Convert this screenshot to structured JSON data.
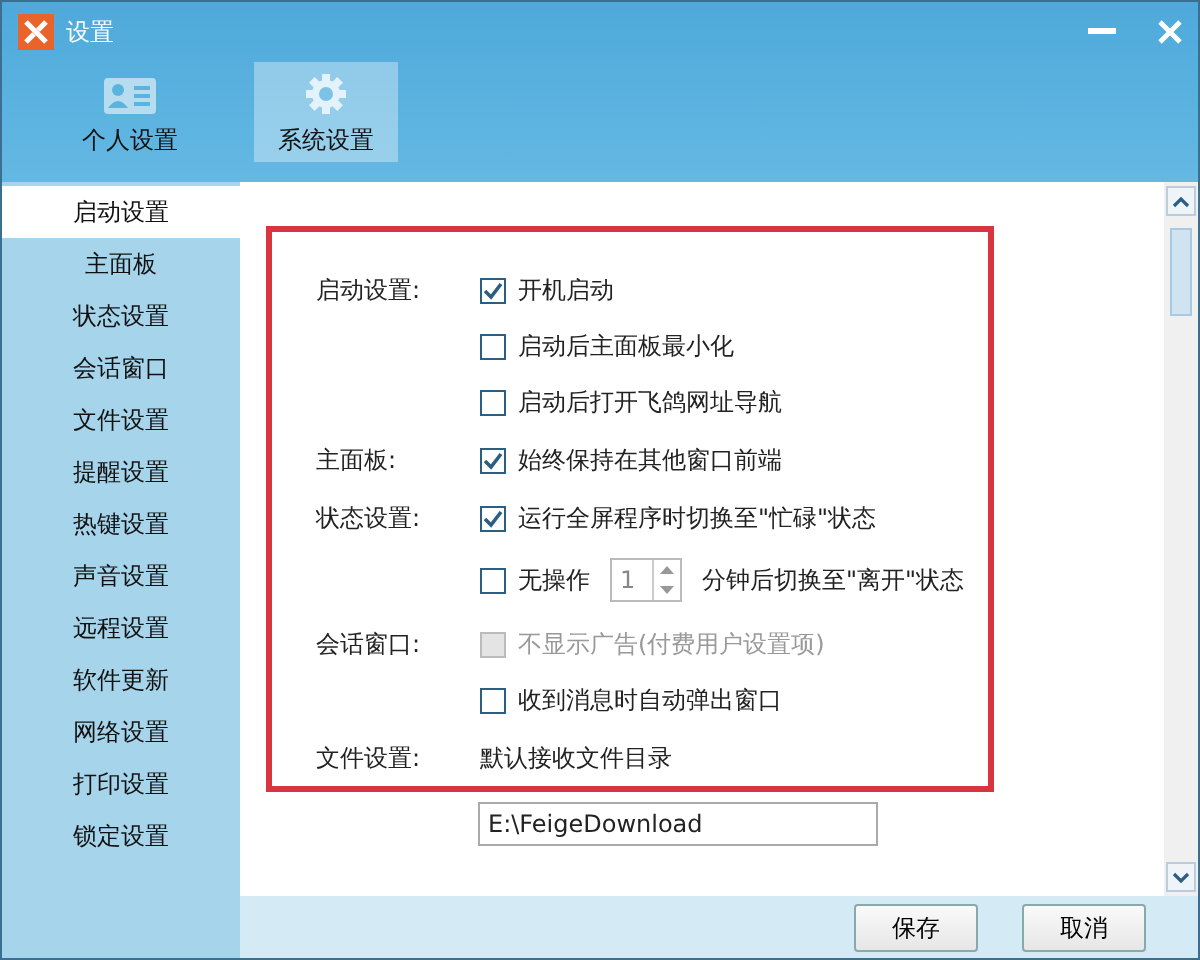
{
  "window": {
    "title": "设置"
  },
  "tabs": [
    {
      "label": "个人设置",
      "selected": false
    },
    {
      "label": "系统设置",
      "selected": true
    }
  ],
  "sidebar": {
    "items": [
      {
        "label": "启动设置",
        "selected": true
      },
      {
        "label": "主面板",
        "selected": false
      },
      {
        "label": "状态设置",
        "selected": false
      },
      {
        "label": "会话窗口",
        "selected": false
      },
      {
        "label": "文件设置",
        "selected": false
      },
      {
        "label": "提醒设置",
        "selected": false
      },
      {
        "label": "热键设置",
        "selected": false
      },
      {
        "label": "声音设置",
        "selected": false
      },
      {
        "label": "远程设置",
        "selected": false
      },
      {
        "label": "软件更新",
        "selected": false
      },
      {
        "label": "网络设置",
        "selected": false
      },
      {
        "label": "打印设置",
        "selected": false
      },
      {
        "label": "锁定设置",
        "selected": false
      }
    ]
  },
  "sections": [
    {
      "label": "启动设置:",
      "options": [
        {
          "kind": "checkbox",
          "label": "开机启动",
          "checked": true,
          "disabled": false
        },
        {
          "kind": "checkbox",
          "label": "启动后主面板最小化",
          "checked": false,
          "disabled": false
        },
        {
          "kind": "checkbox",
          "label": "启动后打开飞鸽网址导航",
          "checked": false,
          "disabled": false
        }
      ]
    },
    {
      "label": "主面板:",
      "options": [
        {
          "kind": "checkbox",
          "label": "始终保持在其他窗口前端",
          "checked": true,
          "disabled": false
        }
      ]
    },
    {
      "label": "状态设置:",
      "options": [
        {
          "kind": "checkbox",
          "label": "运行全屏程序时切换至\"忙碌\"状态",
          "checked": true,
          "disabled": false
        },
        {
          "kind": "spinner",
          "label": "无操作",
          "value": "1",
          "suffix": "分钟后切换至\"离开\"状态",
          "checked": false,
          "disabled": false
        }
      ]
    },
    {
      "label": "会话窗口:",
      "options": [
        {
          "kind": "checkbox",
          "label": "不显示广告(付费用户设置项)",
          "checked": false,
          "disabled": true
        },
        {
          "kind": "checkbox",
          "label": "收到消息时自动弹出窗口",
          "checked": false,
          "disabled": false
        }
      ]
    },
    {
      "label": "文件设置:",
      "options": [
        {
          "kind": "text",
          "label": "默认接收文件目录"
        }
      ]
    }
  ],
  "download_folder": {
    "value": "E:\\FeigeDownload"
  },
  "buttons": [
    {
      "label": "保存"
    },
    {
      "label": "取消"
    }
  ]
}
